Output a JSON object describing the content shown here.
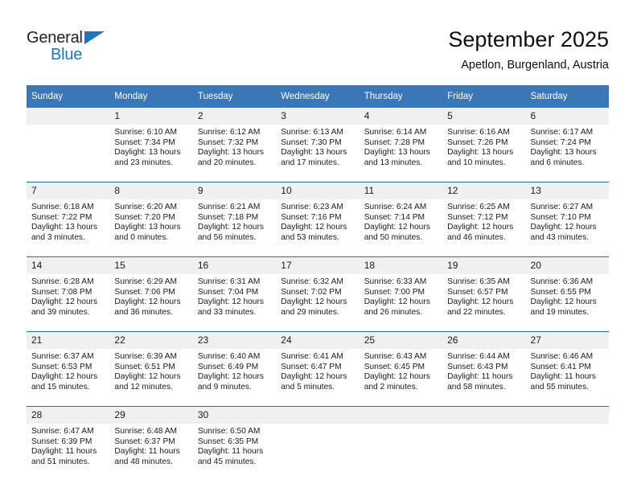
{
  "brand": {
    "name_part1": "General",
    "name_part2": "Blue",
    "accent_color": "#1b75bb"
  },
  "header": {
    "title": "September 2025",
    "subtitle": "Apetlon, Burgenland, Austria"
  },
  "theme": {
    "header_blue": "#3a77b7",
    "daynum_band": "#f0f0f0",
    "row_divider": "#2e6da4"
  },
  "weekday_headers": [
    "Sunday",
    "Monday",
    "Tuesday",
    "Wednesday",
    "Thursday",
    "Friday",
    "Saturday"
  ],
  "weeks": [
    {
      "daynums": [
        "",
        "1",
        "2",
        "3",
        "4",
        "5",
        "6"
      ],
      "cells": [
        {
          "l1": "",
          "l2": "",
          "l3": "",
          "l4": ""
        },
        {
          "l1": "Sunrise: 6:10 AM",
          "l2": "Sunset: 7:34 PM",
          "l3": "Daylight: 13 hours",
          "l4": "and 23 minutes."
        },
        {
          "l1": "Sunrise: 6:12 AM",
          "l2": "Sunset: 7:32 PM",
          "l3": "Daylight: 13 hours",
          "l4": "and 20 minutes."
        },
        {
          "l1": "Sunrise: 6:13 AM",
          "l2": "Sunset: 7:30 PM",
          "l3": "Daylight: 13 hours",
          "l4": "and 17 minutes."
        },
        {
          "l1": "Sunrise: 6:14 AM",
          "l2": "Sunset: 7:28 PM",
          "l3": "Daylight: 13 hours",
          "l4": "and 13 minutes."
        },
        {
          "l1": "Sunrise: 6:16 AM",
          "l2": "Sunset: 7:26 PM",
          "l3": "Daylight: 13 hours",
          "l4": "and 10 minutes."
        },
        {
          "l1": "Sunrise: 6:17 AM",
          "l2": "Sunset: 7:24 PM",
          "l3": "Daylight: 13 hours",
          "l4": "and 6 minutes."
        }
      ]
    },
    {
      "daynums": [
        "7",
        "8",
        "9",
        "10",
        "11",
        "12",
        "13"
      ],
      "cells": [
        {
          "l1": "Sunrise: 6:18 AM",
          "l2": "Sunset: 7:22 PM",
          "l3": "Daylight: 13 hours",
          "l4": "and 3 minutes."
        },
        {
          "l1": "Sunrise: 6:20 AM",
          "l2": "Sunset: 7:20 PM",
          "l3": "Daylight: 13 hours",
          "l4": "and 0 minutes."
        },
        {
          "l1": "Sunrise: 6:21 AM",
          "l2": "Sunset: 7:18 PM",
          "l3": "Daylight: 12 hours",
          "l4": "and 56 minutes."
        },
        {
          "l1": "Sunrise: 6:23 AM",
          "l2": "Sunset: 7:16 PM",
          "l3": "Daylight: 12 hours",
          "l4": "and 53 minutes."
        },
        {
          "l1": "Sunrise: 6:24 AM",
          "l2": "Sunset: 7:14 PM",
          "l3": "Daylight: 12 hours",
          "l4": "and 50 minutes."
        },
        {
          "l1": "Sunrise: 6:25 AM",
          "l2": "Sunset: 7:12 PM",
          "l3": "Daylight: 12 hours",
          "l4": "and 46 minutes."
        },
        {
          "l1": "Sunrise: 6:27 AM",
          "l2": "Sunset: 7:10 PM",
          "l3": "Daylight: 12 hours",
          "l4": "and 43 minutes."
        }
      ]
    },
    {
      "daynums": [
        "14",
        "15",
        "16",
        "17",
        "18",
        "19",
        "20"
      ],
      "cells": [
        {
          "l1": "Sunrise: 6:28 AM",
          "l2": "Sunset: 7:08 PM",
          "l3": "Daylight: 12 hours",
          "l4": "and 39 minutes."
        },
        {
          "l1": "Sunrise: 6:29 AM",
          "l2": "Sunset: 7:06 PM",
          "l3": "Daylight: 12 hours",
          "l4": "and 36 minutes."
        },
        {
          "l1": "Sunrise: 6:31 AM",
          "l2": "Sunset: 7:04 PM",
          "l3": "Daylight: 12 hours",
          "l4": "and 33 minutes."
        },
        {
          "l1": "Sunrise: 6:32 AM",
          "l2": "Sunset: 7:02 PM",
          "l3": "Daylight: 12 hours",
          "l4": "and 29 minutes."
        },
        {
          "l1": "Sunrise: 6:33 AM",
          "l2": "Sunset: 7:00 PM",
          "l3": "Daylight: 12 hours",
          "l4": "and 26 minutes."
        },
        {
          "l1": "Sunrise: 6:35 AM",
          "l2": "Sunset: 6:57 PM",
          "l3": "Daylight: 12 hours",
          "l4": "and 22 minutes."
        },
        {
          "l1": "Sunrise: 6:36 AM",
          "l2": "Sunset: 6:55 PM",
          "l3": "Daylight: 12 hours",
          "l4": "and 19 minutes."
        }
      ]
    },
    {
      "daynums": [
        "21",
        "22",
        "23",
        "24",
        "25",
        "26",
        "27"
      ],
      "cells": [
        {
          "l1": "Sunrise: 6:37 AM",
          "l2": "Sunset: 6:53 PM",
          "l3": "Daylight: 12 hours",
          "l4": "and 15 minutes."
        },
        {
          "l1": "Sunrise: 6:39 AM",
          "l2": "Sunset: 6:51 PM",
          "l3": "Daylight: 12 hours",
          "l4": "and 12 minutes."
        },
        {
          "l1": "Sunrise: 6:40 AM",
          "l2": "Sunset: 6:49 PM",
          "l3": "Daylight: 12 hours",
          "l4": "and 9 minutes."
        },
        {
          "l1": "Sunrise: 6:41 AM",
          "l2": "Sunset: 6:47 PM",
          "l3": "Daylight: 12 hours",
          "l4": "and 5 minutes."
        },
        {
          "l1": "Sunrise: 6:43 AM",
          "l2": "Sunset: 6:45 PM",
          "l3": "Daylight: 12 hours",
          "l4": "and 2 minutes."
        },
        {
          "l1": "Sunrise: 6:44 AM",
          "l2": "Sunset: 6:43 PM",
          "l3": "Daylight: 11 hours",
          "l4": "and 58 minutes."
        },
        {
          "l1": "Sunrise: 6:46 AM",
          "l2": "Sunset: 6:41 PM",
          "l3": "Daylight: 11 hours",
          "l4": "and 55 minutes."
        }
      ]
    },
    {
      "daynums": [
        "28",
        "29",
        "30",
        "",
        "",
        "",
        ""
      ],
      "cells": [
        {
          "l1": "Sunrise: 6:47 AM",
          "l2": "Sunset: 6:39 PM",
          "l3": "Daylight: 11 hours",
          "l4": "and 51 minutes."
        },
        {
          "l1": "Sunrise: 6:48 AM",
          "l2": "Sunset: 6:37 PM",
          "l3": "Daylight: 11 hours",
          "l4": "and 48 minutes."
        },
        {
          "l1": "Sunrise: 6:50 AM",
          "l2": "Sunset: 6:35 PM",
          "l3": "Daylight: 11 hours",
          "l4": "and 45 minutes."
        },
        {
          "l1": "",
          "l2": "",
          "l3": "",
          "l4": ""
        },
        {
          "l1": "",
          "l2": "",
          "l3": "",
          "l4": ""
        },
        {
          "l1": "",
          "l2": "",
          "l3": "",
          "l4": ""
        },
        {
          "l1": "",
          "l2": "",
          "l3": "",
          "l4": ""
        }
      ]
    }
  ]
}
